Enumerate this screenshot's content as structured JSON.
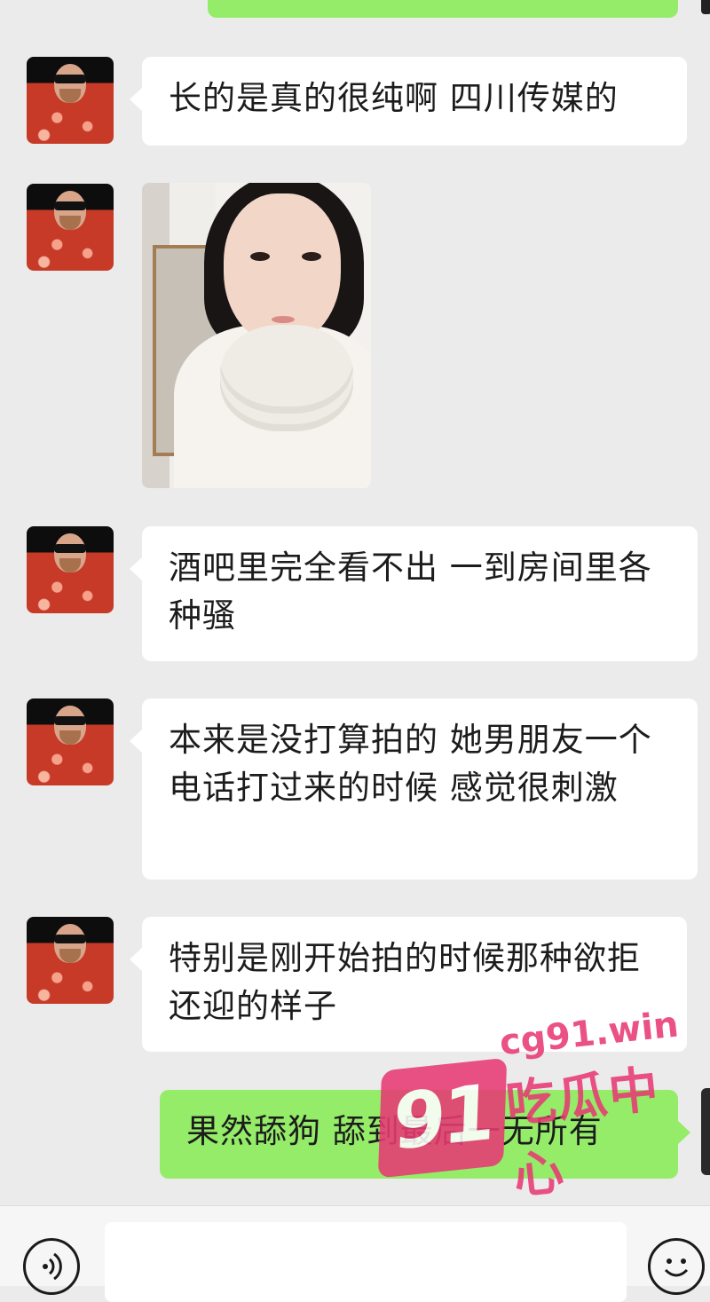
{
  "messages": [
    {
      "side": "left",
      "type": "text",
      "text": "长的是真的很纯啊  四川传媒的"
    },
    {
      "side": "left",
      "type": "image"
    },
    {
      "side": "left",
      "type": "text",
      "text": "酒吧里完全看不出 一到房间里各种骚"
    },
    {
      "side": "left",
      "type": "text",
      "text": "本来是没打算拍的  她男朋友一个电话打过来的时候 感觉很刺激"
    },
    {
      "side": "left",
      "type": "text",
      "text": "特别是刚开始拍的时候那种欲拒还迎的样子"
    },
    {
      "side": "right",
      "type": "text",
      "text": "果然舔狗 舔到最后一无所有"
    }
  ],
  "watermark": {
    "logo": "91",
    "url": "cg91.win",
    "name": "吃瓜中心",
    "color": "#e83a74"
  },
  "input_bar": {
    "voice_icon": "voice-icon",
    "emoji_icon": "emoji-icon"
  },
  "colors": {
    "background": "#ebebeb",
    "incoming_bubble": "#ffffff",
    "outgoing_bubble": "#95ec69"
  }
}
